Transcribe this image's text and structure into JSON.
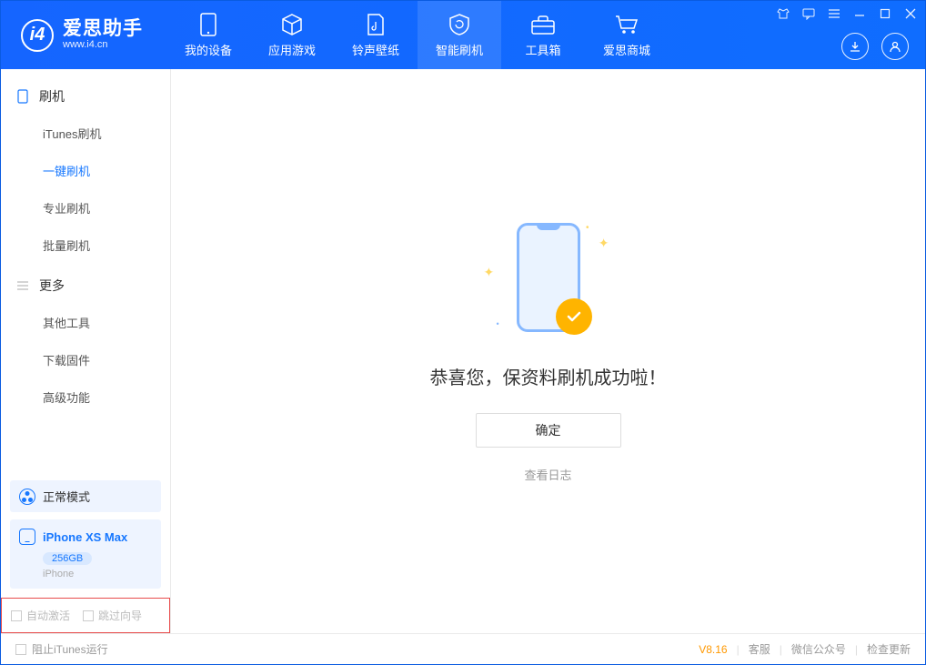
{
  "app": {
    "title": "爱思助手",
    "subtitle": "www.i4.cn"
  },
  "nav": {
    "tabs": [
      {
        "label": "我的设备",
        "icon": "device"
      },
      {
        "label": "应用游戏",
        "icon": "cube"
      },
      {
        "label": "铃声壁纸",
        "icon": "music"
      },
      {
        "label": "智能刷机",
        "icon": "shield",
        "active": true
      },
      {
        "label": "工具箱",
        "icon": "toolbox"
      },
      {
        "label": "爱思商城",
        "icon": "cart"
      }
    ]
  },
  "sidebar": {
    "sections": [
      {
        "title": "刷机",
        "items": [
          {
            "label": "iTunes刷机"
          },
          {
            "label": "一键刷机",
            "active": true
          },
          {
            "label": "专业刷机"
          },
          {
            "label": "批量刷机"
          }
        ]
      },
      {
        "title": "更多",
        "items": [
          {
            "label": "其他工具"
          },
          {
            "label": "下载固件"
          },
          {
            "label": "高级功能"
          }
        ]
      }
    ],
    "mode_label": "正常模式",
    "device": {
      "name": "iPhone XS Max",
      "storage": "256GB",
      "type": "iPhone"
    },
    "options": {
      "auto_activate": "自动激活",
      "skip_guide": "跳过向导"
    }
  },
  "main": {
    "success_text": "恭喜您，保资料刷机成功啦！",
    "confirm_label": "确定",
    "view_log_label": "查看日志"
  },
  "footer": {
    "block_itunes": "阻止iTunes运行",
    "version": "V8.16",
    "links": {
      "service": "客服",
      "wechat": "微信公众号",
      "update": "检查更新"
    }
  }
}
